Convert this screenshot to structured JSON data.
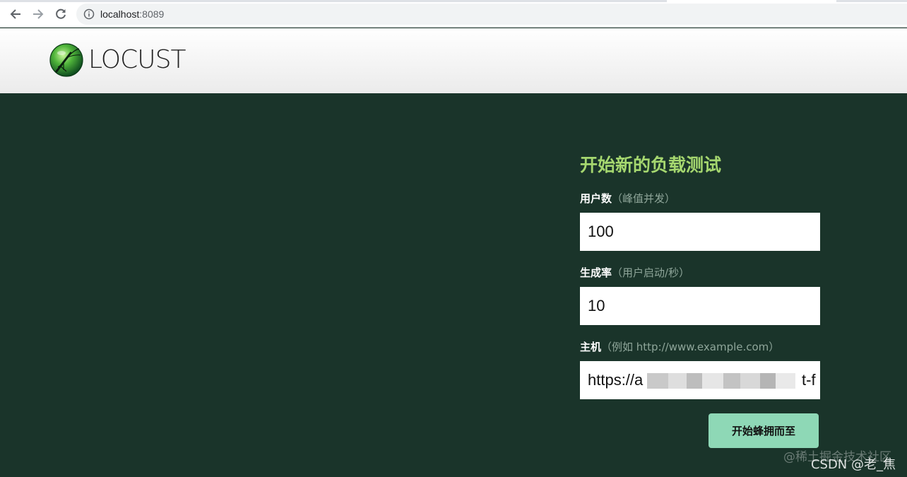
{
  "browser": {
    "url_host": "localhost",
    "url_port": ":8089",
    "icons": [
      "back-arrow-icon",
      "forward-arrow-icon",
      "reload-icon",
      "info-icon"
    ]
  },
  "header": {
    "brand": "LOCUST",
    "logo_icon": "locust-logo-icon"
  },
  "form": {
    "title": "开始新的负载测试",
    "users_label": "用户数",
    "users_hint": "（峰值并发）",
    "users_value": "100",
    "spawn_label": "生成率",
    "spawn_hint": "（用户启动/秒）",
    "spawn_value": "10",
    "host_label": "主机",
    "host_hint": "（例如 http://www.example.com）",
    "host_value_visible": "https://a",
    "host_value_tail": "t-f",
    "start_button": "开始蜂拥而至"
  },
  "watermark": {
    "line1": "@稀土掘金技术社区",
    "line2": "CSDN @老_焦"
  },
  "colors": {
    "background": "#1a342a",
    "title": "#a5d76f",
    "button": "#8ed8b6"
  }
}
